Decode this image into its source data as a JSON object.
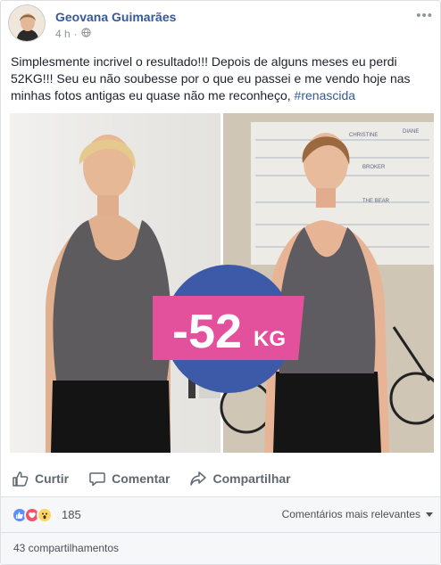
{
  "post": {
    "author": "Geovana Guimarães",
    "time": "4 h",
    "privacy_icon": "globe-icon",
    "text": "Simplesmente incrivel o resultado!!! Depois de alguns meses eu perdi 52KG!!! Seu eu não soubesse por o que eu passei e me vendo hoje nas minhas fotos antigas eu quase não me reconheço,",
    "hashtag": "#renascida"
  },
  "photo": {
    "badge_value": "-52",
    "badge_unit": "KG",
    "badge_colors": {
      "blue": "#3d5aa8",
      "pink": "#e3519c"
    },
    "board_texts": [
      "CHRISTINE",
      "DIANE",
      "BROKER",
      "THE BEAR"
    ]
  },
  "actions": {
    "like": "Curtir",
    "comment": "Comentar",
    "share": "Compartilhar"
  },
  "reactions": {
    "icons": [
      "like-icon",
      "love-icon",
      "wow-icon"
    ],
    "count": "185",
    "sort_label": "Comentários mais relevantes"
  },
  "shares": {
    "label": "43 compartilhamentos"
  }
}
